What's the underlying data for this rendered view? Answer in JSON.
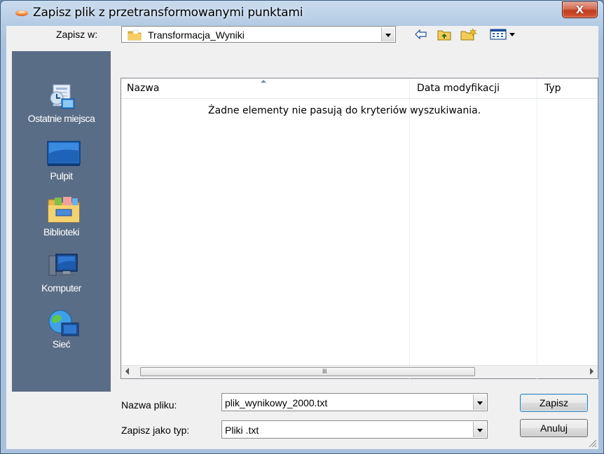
{
  "title": "Zapisz plik z przetransformowanymi punktami",
  "close_glyph": "X",
  "save_in": {
    "label": "Zapisz w:",
    "value": "Transformacja_Wyniki"
  },
  "places": [
    {
      "label": "Ostatnie miejsca",
      "icon": "recent-places-icon"
    },
    {
      "label": "Pulpit",
      "icon": "desktop-icon"
    },
    {
      "label": "Biblioteki",
      "icon": "libraries-icon"
    },
    {
      "label": "Komputer",
      "icon": "computer-icon"
    },
    {
      "label": "Sieć",
      "icon": "network-icon"
    }
  ],
  "columns": [
    "Nazwa",
    "Data modyfikacji",
    "Typ"
  ],
  "empty_message": "Żadne elementy nie pasują do kryteriów wyszukiwania.",
  "scroll_grip": "III",
  "filename": {
    "label": "Nazwa pliku:",
    "value": "plik_wynikowy_2000.txt"
  },
  "filetype": {
    "label": "Zapisz jako typ:",
    "value": "Pliki .txt"
  },
  "buttons": {
    "save": "Zapisz",
    "cancel": "Anuluj"
  },
  "colors": {
    "places_bar": "#5a6d87",
    "title_accent": "#c03c1c",
    "default_button_border": "#3c7fb1"
  }
}
